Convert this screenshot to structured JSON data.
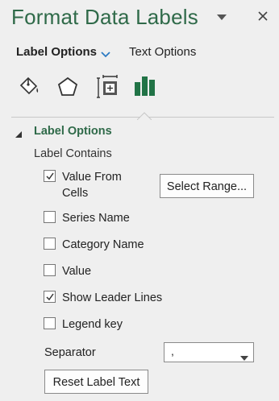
{
  "pane": {
    "title": "Format Data Labels",
    "accent_color": "#2f6a49"
  },
  "tabs": {
    "label_options": "Label Options",
    "text_options": "Text Options"
  },
  "category_icons": [
    "fill-line-icon",
    "effects-pentagon-icon",
    "size-properties-icon",
    "label-options-bar-chart-icon"
  ],
  "section": {
    "title": "Label Options",
    "subheading": "Label Contains"
  },
  "checkboxes": [
    {
      "label": "Value From Cells",
      "checked": true
    },
    {
      "label": "Series Name",
      "checked": false
    },
    {
      "label": "Category Name",
      "checked": false
    },
    {
      "label": "Value",
      "checked": false
    },
    {
      "label": "Show Leader Lines",
      "checked": true
    },
    {
      "label": "Legend key",
      "checked": false
    }
  ],
  "select_range_label": "Select Range...",
  "separator": {
    "label": "Separator",
    "value": ","
  },
  "reset_label": "Reset Label Text"
}
